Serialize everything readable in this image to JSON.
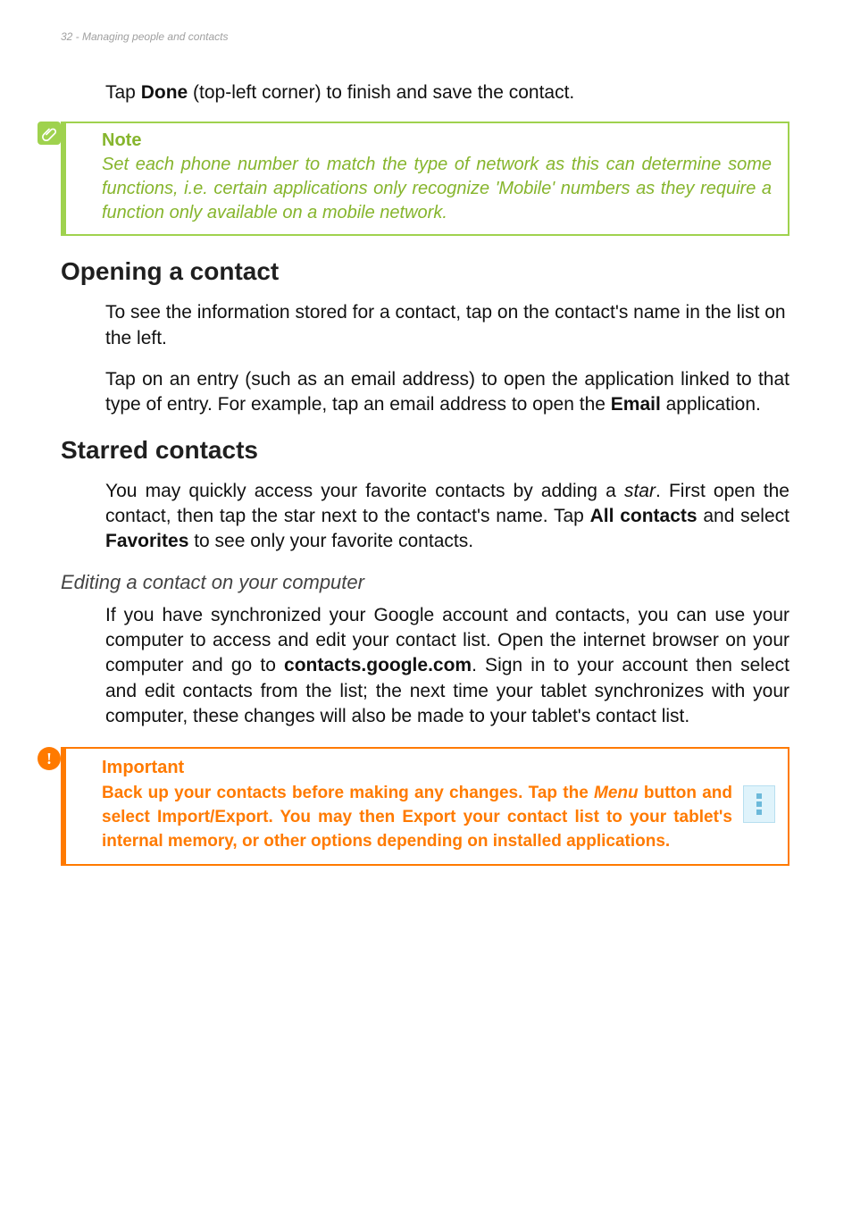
{
  "header": {
    "text": "32 - Managing people and contacts"
  },
  "intro": {
    "pre": "Tap ",
    "bold": "Done",
    "post": " (top-left corner) to finish and save the contact."
  },
  "note": {
    "title": "Note",
    "body": "Set each phone number to match the type of network as this can determine some functions, i.e. certain applications only recognize 'Mobile' numbers as they require a function only available on a mobile network."
  },
  "section_open": {
    "heading": "Opening a contact",
    "p1": "To see the information stored for a contact, tap on the contact's name in the list on the left.",
    "p2_pre": "Tap on an entry (such as an email address) to open the application linked to that type of entry. For example, tap an email address to open the ",
    "p2_bold": "Email",
    "p2_post": " application."
  },
  "section_starred": {
    "heading": "Starred contacts",
    "p_pre": "You may quickly access your favorite contacts by adding a ",
    "p_star": "star",
    "p_mid1": ". First open the contact, then tap the star next to the contact's name. Tap ",
    "p_all": "All contacts",
    "p_mid2": " and select ",
    "p_fav": "Favorites",
    "p_post": " to see only your favorite contacts."
  },
  "section_edit": {
    "heading": "Editing a contact on your computer",
    "p_pre": "If you have synchronized your Google account and contacts, you can use your computer to access and edit your contact list. Open the internet browser on your computer and go to ",
    "p_link": "contacts.google.com",
    "p_post": ". Sign in to your account then select and edit contacts from the list; the next time your tablet synchronizes with your computer, these changes will also be made to your tablet's contact list."
  },
  "important": {
    "title": "Important",
    "body_pre": "Back up your contacts before making any changes. Tap the ",
    "body_menu": "Menu",
    "body_post": " button and select Import/Export. You may then Export your contact list to your tablet's internal memory, or other options depending on installed applications."
  }
}
